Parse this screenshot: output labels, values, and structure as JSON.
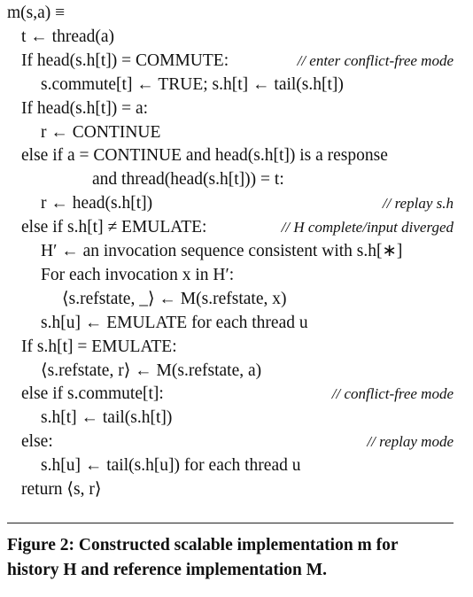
{
  "lines": [
    {
      "text": "m(s,a) ≡",
      "indent": 0,
      "comment": ""
    },
    {
      "text": "t ← thread(a)",
      "indent": 1,
      "comment": ""
    },
    {
      "text": "If head(s.h[t]) = COMMUTE:",
      "indent": 1,
      "comment": "// enter conflict-free mode"
    },
    {
      "text": "s.commute[t] ← TRUE;  s.h[t] ← tail(s.h[t])",
      "indent": 2,
      "comment": ""
    },
    {
      "text": "If head(s.h[t]) = a:",
      "indent": 1,
      "comment": ""
    },
    {
      "text": "r ← CONTINUE",
      "indent": 2,
      "comment": ""
    },
    {
      "text": "else if a = CONTINUE and head(s.h[t]) is a response",
      "indent": 1,
      "comment": ""
    },
    {
      "text": "and thread(head(s.h[t])) = t:",
      "indent": 4,
      "comment": ""
    },
    {
      "text": "r ← head(s.h[t])",
      "indent": 2,
      "comment": "// replay s.h"
    },
    {
      "text": "else if s.h[t] ≠ EMULATE:",
      "indent": 1,
      "comment": "// H complete/input diverged"
    },
    {
      "text": "H′ ← an invocation sequence consistent with s.h[∗]",
      "indent": 2,
      "comment": ""
    },
    {
      "text": "For each invocation x in H′:",
      "indent": 2,
      "comment": ""
    },
    {
      "text": "⟨s.refstate, _⟩ ← M(s.refstate, x)",
      "indent": 3,
      "comment": ""
    },
    {
      "text": "s.h[u] ← EMULATE for each thread u",
      "indent": 2,
      "comment": ""
    },
    {
      "text": "If s.h[t] = EMULATE:",
      "indent": 1,
      "comment": ""
    },
    {
      "text": "⟨s.refstate, r⟩ ← M(s.refstate, a)",
      "indent": 2,
      "comment": ""
    },
    {
      "text": "else if s.commute[t]:",
      "indent": 1,
      "comment": "// conflict-free mode"
    },
    {
      "text": "s.h[t] ← tail(s.h[t])",
      "indent": 2,
      "comment": ""
    },
    {
      "text": "else:",
      "indent": 1,
      "comment": "// replay mode"
    },
    {
      "text": "s.h[u] ← tail(s.h[u]) for each thread u",
      "indent": 2,
      "comment": ""
    },
    {
      "text": "return ⟨s, r⟩",
      "indent": 1,
      "comment": ""
    }
  ],
  "caption": {
    "line1": "Figure 2: Constructed scalable implementation m for",
    "line2": "history H and reference implementation M."
  }
}
